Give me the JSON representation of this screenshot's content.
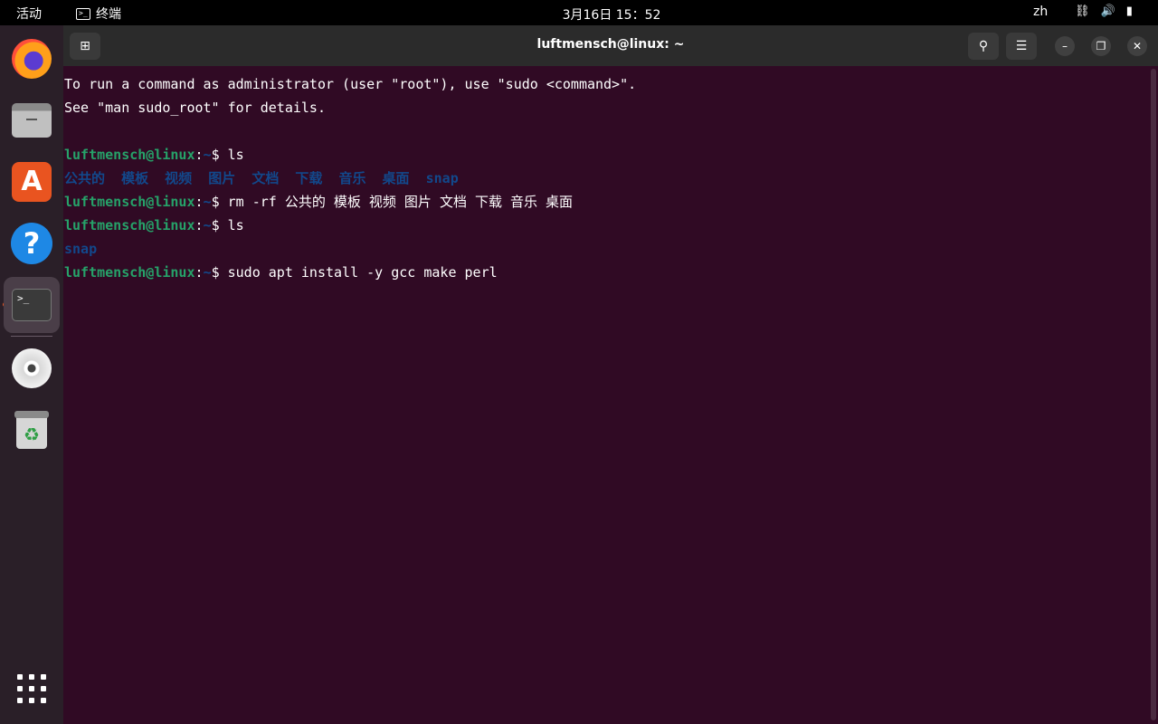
{
  "topbar": {
    "activities": "活动",
    "app_name": "终端",
    "clock": "3月16日  15：52",
    "lang": "zh"
  },
  "window": {
    "title": "luftmensch@linux: ~"
  },
  "terminal": {
    "intro1": "To run a command as administrator (user \"root\"), use \"sudo <command>\".",
    "intro2": "See \"man sudo_root\" for details.",
    "prompt_user": "luftmensch@linux",
    "prompt_colon": ":",
    "prompt_path": "~",
    "prompt_dollar": "$ ",
    "cmd1": "ls",
    "ls1_dirs": [
      "公共的",
      "模板",
      "视频",
      "图片",
      "文档",
      "下载",
      "音乐",
      "桌面",
      "snap"
    ],
    "cmd2": "rm -rf 公共的 模板 视频 图片 文档 下载 音乐 桌面",
    "cmd3": "ls",
    "ls2_dirs": [
      "snap"
    ],
    "cmd4": "sudo apt install -y gcc make perl"
  },
  "colors": {
    "terminal_bg": "#300a24",
    "prompt_user": "#26a269",
    "prompt_path": "#12488b",
    "accent": "#e95420"
  }
}
